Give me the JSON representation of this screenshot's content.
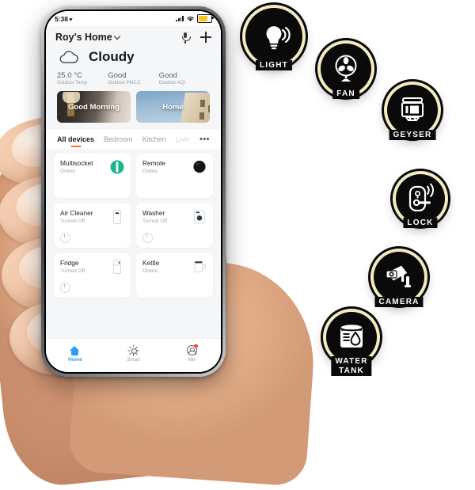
{
  "phone": {
    "status_bar": {
      "time": "5:38",
      "location_icon": "location-arrow-icon",
      "signal_icon": "cellular-signal-icon",
      "wifi_icon": "wifi-icon",
      "battery_icon": "battery-icon",
      "battery_color": "#fdc51c"
    },
    "header": {
      "home_name": "Roy's Home",
      "dropdown_icon": "chevron-down-icon",
      "mic_icon": "microphone-icon",
      "add_icon": "plus-icon"
    },
    "weather": {
      "condition": "Cloudy",
      "icon": "cloud-icon",
      "stats": [
        {
          "value": "25.0 °C",
          "label": "Outdoor Temp"
        },
        {
          "value": "Good",
          "label": "Outdoor PM2.5"
        },
        {
          "value": "Good",
          "label": "Outdoor AQI"
        }
      ]
    },
    "scenes": [
      {
        "label": "Good Morning",
        "name": "scene-good-morning"
      },
      {
        "label": "Home",
        "name": "scene-home"
      }
    ],
    "tabs": [
      {
        "label": "All devices",
        "active": true
      },
      {
        "label": "Bedroom",
        "active": false
      },
      {
        "label": "Kitchen",
        "active": false
      },
      {
        "label": "Living",
        "active": false
      }
    ],
    "tabs_more_icon": "•••",
    "active_tab_color": "#ff6a2a",
    "devices": [
      {
        "name": "Multisocket",
        "status": "Online",
        "icon": "multisocket-icon",
        "power_button": false
      },
      {
        "name": "Remote",
        "status": "Online",
        "icon": "remote-icon",
        "power_button": false
      },
      {
        "name": "Air Cleaner",
        "status": "Turned Off",
        "icon": "air-cleaner-icon",
        "power_button": true
      },
      {
        "name": "Washer",
        "status": "Turned Off",
        "icon": "washer-icon",
        "power_button": true
      },
      {
        "name": "Fridge",
        "status": "Turned Off",
        "icon": "fridge-icon",
        "power_button": true
      },
      {
        "name": "Kettle",
        "status": "Online",
        "icon": "kettle-icon",
        "power_button": false
      }
    ],
    "bottom_nav": [
      {
        "label": "Home",
        "icon": "home-icon",
        "active": true,
        "badge": false
      },
      {
        "label": "Smart",
        "icon": "sun-icon",
        "active": false,
        "badge": false
      },
      {
        "label": "Me",
        "icon": "user-icon",
        "active": false,
        "badge": true
      }
    ],
    "nav_active_color": "#2b9cf7",
    "badge_color": "#f4433a"
  },
  "product_badges": [
    {
      "label": "LIGHT",
      "icon": "light-bulb-icon"
    },
    {
      "label": "FAN",
      "icon": "fan-icon"
    },
    {
      "label": "GEYSER",
      "icon": "geyser-icon"
    },
    {
      "label": "LOCK",
      "icon": "smart-lock-icon"
    },
    {
      "label": "CAMERA",
      "icon": "cctv-camera-icon"
    },
    {
      "label": "WATER\nTANK",
      "icon": "water-tank-icon"
    }
  ],
  "badge_ring_color": "#f2ecc0"
}
